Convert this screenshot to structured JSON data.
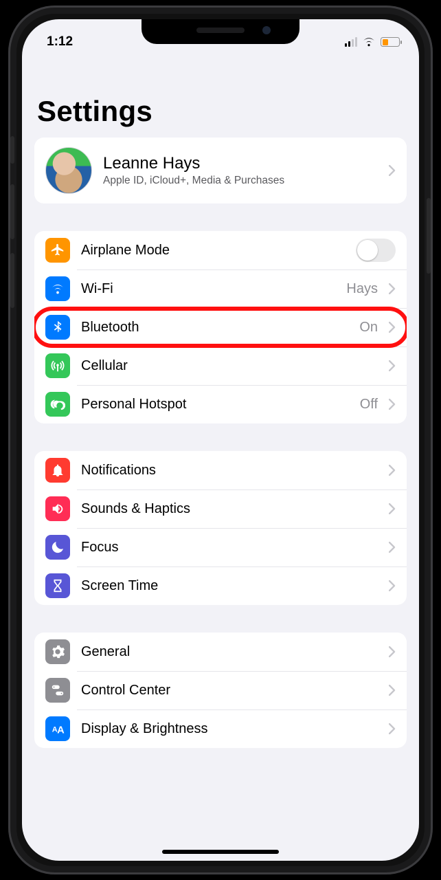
{
  "status": {
    "time": "1:12"
  },
  "title": "Settings",
  "profile": {
    "name": "Leanne Hays",
    "subtitle": "Apple ID, iCloud+, Media & Purchases"
  },
  "groups": [
    {
      "rows": [
        {
          "icon": "airplane",
          "color": "ic-orange",
          "label": "Airplane Mode",
          "type": "toggle",
          "on": false
        },
        {
          "icon": "wifi",
          "color": "ic-blue",
          "label": "Wi-Fi",
          "type": "link",
          "value": "Hays"
        },
        {
          "icon": "bluetooth",
          "color": "ic-blue",
          "label": "Bluetooth",
          "type": "link",
          "value": "On",
          "highlighted": true
        },
        {
          "icon": "antenna",
          "color": "ic-green",
          "label": "Cellular",
          "type": "link"
        },
        {
          "icon": "hotspot",
          "color": "ic-greenb",
          "label": "Personal Hotspot",
          "type": "link",
          "value": "Off"
        }
      ]
    },
    {
      "rows": [
        {
          "icon": "bell",
          "color": "ic-red",
          "label": "Notifications",
          "type": "link"
        },
        {
          "icon": "speaker",
          "color": "ic-pink",
          "label": "Sounds & Haptics",
          "type": "link"
        },
        {
          "icon": "moon",
          "color": "ic-indigo",
          "label": "Focus",
          "type": "link"
        },
        {
          "icon": "hourglass",
          "color": "ic-indigo",
          "label": "Screen Time",
          "type": "link"
        }
      ]
    },
    {
      "rows": [
        {
          "icon": "gear",
          "color": "ic-gray",
          "label": "General",
          "type": "link"
        },
        {
          "icon": "switches",
          "color": "ic-gray2",
          "label": "Control Center",
          "type": "link"
        },
        {
          "icon": "aa",
          "color": "ic-blue2",
          "label": "Display & Brightness",
          "type": "link"
        }
      ]
    }
  ]
}
